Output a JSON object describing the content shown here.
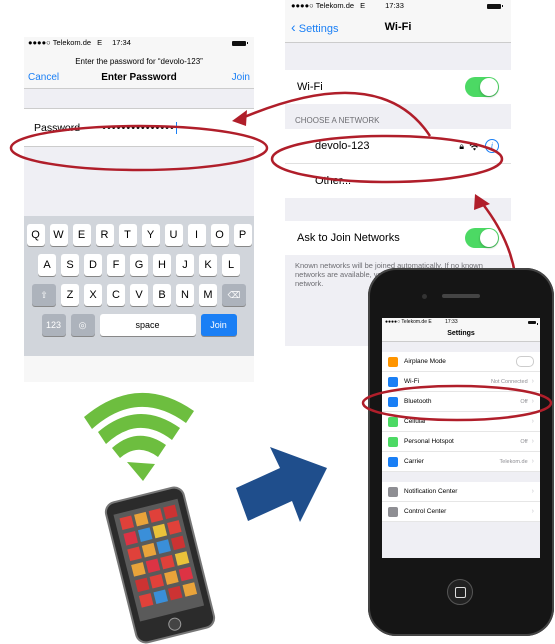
{
  "password_screen": {
    "status": {
      "carrier": "Telekom.de",
      "network": "E",
      "time": "17:34"
    },
    "prompt": "Enter the password for “devolo-123”",
    "cancel": "Cancel",
    "title": "Enter Password",
    "join": "Join",
    "field_label": "Password",
    "field_value": "•••••••••••••••",
    "keyboard": {
      "row1": [
        "Q",
        "W",
        "E",
        "R",
        "T",
        "Y",
        "U",
        "I",
        "O",
        "P"
      ],
      "row2": [
        "A",
        "S",
        "D",
        "F",
        "G",
        "H",
        "J",
        "K",
        "L"
      ],
      "row3": [
        "Z",
        "X",
        "C",
        "V",
        "B",
        "N",
        "M"
      ],
      "numbers": "123",
      "space": "space",
      "join": "Join"
    }
  },
  "wifi_screen": {
    "status": {
      "carrier": "Telekom.de",
      "network": "E",
      "time": "17:33"
    },
    "back": "Settings",
    "title": "Wi-Fi",
    "wifi_label": "Wi-Fi",
    "section_header": "CHOOSE A NETWORK",
    "network_name": "devolo-123",
    "other": "Other...",
    "ask_join": "Ask to Join Networks",
    "footer": "Known networks will be joined automatically. If no known networks are available, you will have to manually select a network."
  },
  "phone_screen": {
    "status": {
      "carrier": "Telekom.de",
      "network": "E",
      "time": "17:33"
    },
    "title": "Settings",
    "items": [
      {
        "label": "Airplane Mode",
        "value": "",
        "color": "#ff9500",
        "icon": "airplane-icon"
      },
      {
        "label": "Wi-Fi",
        "value": "Not Connected",
        "color": "#1a7ff5",
        "icon": "wifi-icon"
      },
      {
        "label": "Bluetooth",
        "value": "Off",
        "color": "#1a7ff5",
        "icon": "bluetooth-icon"
      },
      {
        "label": "Cellular",
        "value": "",
        "color": "#4cd964",
        "icon": "cellular-icon"
      },
      {
        "label": "Personal Hotspot",
        "value": "Off",
        "color": "#4cd964",
        "icon": "hotspot-icon"
      },
      {
        "label": "Carrier",
        "value": "Telekom.de",
        "color": "#1a7ff5",
        "icon": "carrier-icon"
      },
      {
        "label": "Notification Center",
        "value": "",
        "color": "#8e8e93",
        "icon": "notification-icon"
      },
      {
        "label": "Control Center",
        "value": "",
        "color": "#8e8e93",
        "icon": "control-center-icon"
      }
    ]
  },
  "colors": {
    "accent": "#1a7ff5",
    "highlight": "#b01e2a",
    "toggle_on": "#4cd964",
    "wifi_green": "#6dbe3f",
    "arrow": "#1f4e8c"
  }
}
